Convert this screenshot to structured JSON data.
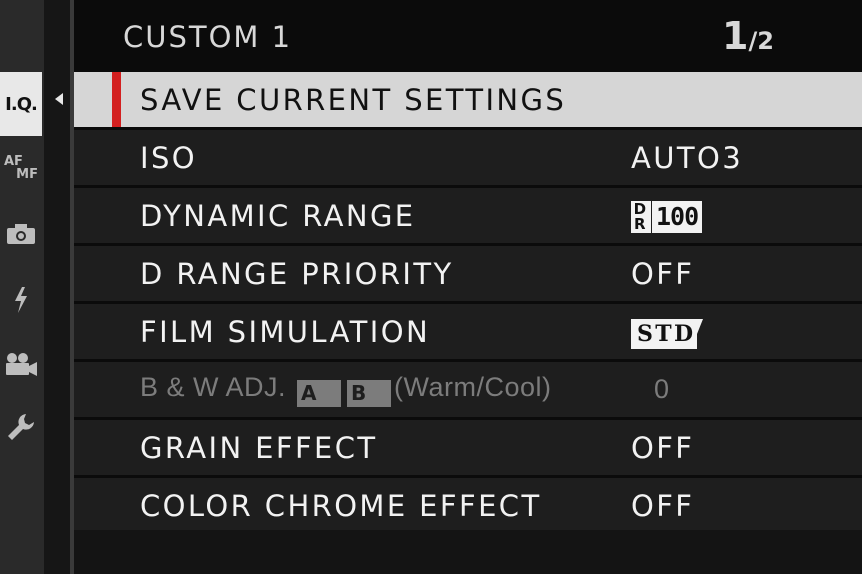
{
  "header": {
    "title": "CUSTOM 1",
    "page_current": "1",
    "page_total": "/2"
  },
  "tabs": [
    {
      "label": "I.Q.",
      "icon": "image-quality-tab",
      "active": true
    },
    {
      "label_top": "AF",
      "label_bottom": "MF",
      "icon": "af-mf-tab"
    },
    {
      "icon": "camera-icon"
    },
    {
      "icon": "flash-icon"
    },
    {
      "icon": "movie-camera-icon"
    },
    {
      "icon": "wrench-icon"
    }
  ],
  "menu": {
    "items": [
      {
        "label": "SAVE CURRENT SETTINGS",
        "value": "",
        "selected": true
      },
      {
        "label": "ISO",
        "value": "AUTO3"
      },
      {
        "label": "DYNAMIC RANGE",
        "value_icon": "dynamic-range-100-icon",
        "icon_prefix_top": "D",
        "icon_prefix_bottom": "R",
        "icon_value": "100"
      },
      {
        "label": "D RANGE PRIORITY",
        "value": "OFF"
      },
      {
        "label": "FILM SIMULATION",
        "value_icon": "film-simulation-std-icon",
        "icon_value": "STD"
      },
      {
        "label_prefix": "B & W ADJ.",
        "label_icon_a": "A",
        "label_icon_b": "B",
        "label_suffix": "(Warm/Cool)",
        "value": "0",
        "disabled": true
      },
      {
        "label": "GRAIN EFFECT",
        "value": "OFF"
      },
      {
        "label": "COLOR CHROME EFFECT",
        "value": "OFF"
      }
    ]
  },
  "colors": {
    "background": "#0b0b0b",
    "selected_row": "#d6d6d6",
    "selection_marker": "#d31f1f",
    "row": "#1e1e1e",
    "disabled_text": "#7c7c7c"
  }
}
